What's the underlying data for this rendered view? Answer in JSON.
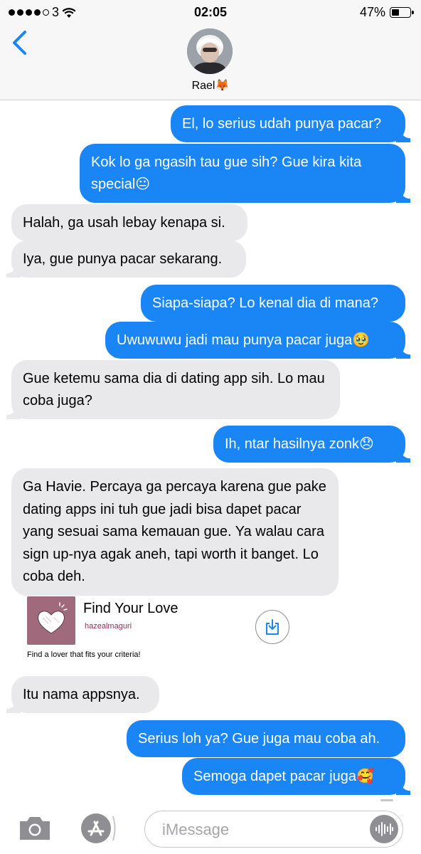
{
  "status_bar": {
    "carrier": "3",
    "time": "02:05",
    "battery_percent": "47%",
    "battery_level": 0.47
  },
  "contact": {
    "name": "Rael🦊"
  },
  "messages": [
    {
      "dir": "out",
      "text": "El, lo serius udah punya pacar?"
    },
    {
      "dir": "out",
      "text": "Kok lo ga ngasih tau gue sih? Gue kira kita special😐"
    },
    {
      "dir": "in",
      "text": "Halah, ga usah lebay kenapa si."
    },
    {
      "dir": "in",
      "text": "Iya, gue punya pacar sekarang."
    },
    {
      "dir": "out",
      "text": "Siapa-siapa? Lo kenal dia di mana?"
    },
    {
      "dir": "out",
      "text": "Uwuwuwu jadi mau punya pacar juga🥹"
    },
    {
      "dir": "in",
      "text": "Gue ketemu sama dia di dating app sih. Lo mau coba juga?"
    },
    {
      "dir": "out",
      "text": "Ih, ntar hasilnya zonk😞"
    },
    {
      "dir": "in",
      "text": "Ga Havie. Percaya ga percaya karena gue pake dating apps ini tuh gue jadi bisa dapet pacar yang sesuai sama kemauan gue.  Ya walau cara sign up-nya agak aneh, tapi worth it banget. Lo coba deh."
    },
    {
      "dir": "in",
      "text": "Itu nama appsnya."
    },
    {
      "dir": "out",
      "text": "Serius loh ya? Gue juga mau coba ah."
    },
    {
      "dir": "out",
      "text": "Semoga dapet pacar juga🥰"
    }
  ],
  "app_card": {
    "name": "Find Your Love",
    "developer": "hazealmaguri",
    "tagline": "Find a lover that fits your criteria!"
  },
  "input": {
    "placeholder": "iMessage"
  },
  "icons": {
    "back": "chevron-left-icon",
    "camera": "camera-icon",
    "appstore": "app-store-icon",
    "download": "download-icon",
    "audio": "waveform-icon"
  },
  "colors": {
    "outgoing_bubble": "#1a86f5",
    "incoming_bubble": "#e9e9eb",
    "accent": "#1a86f5",
    "app_icon": "#a06a7d"
  }
}
